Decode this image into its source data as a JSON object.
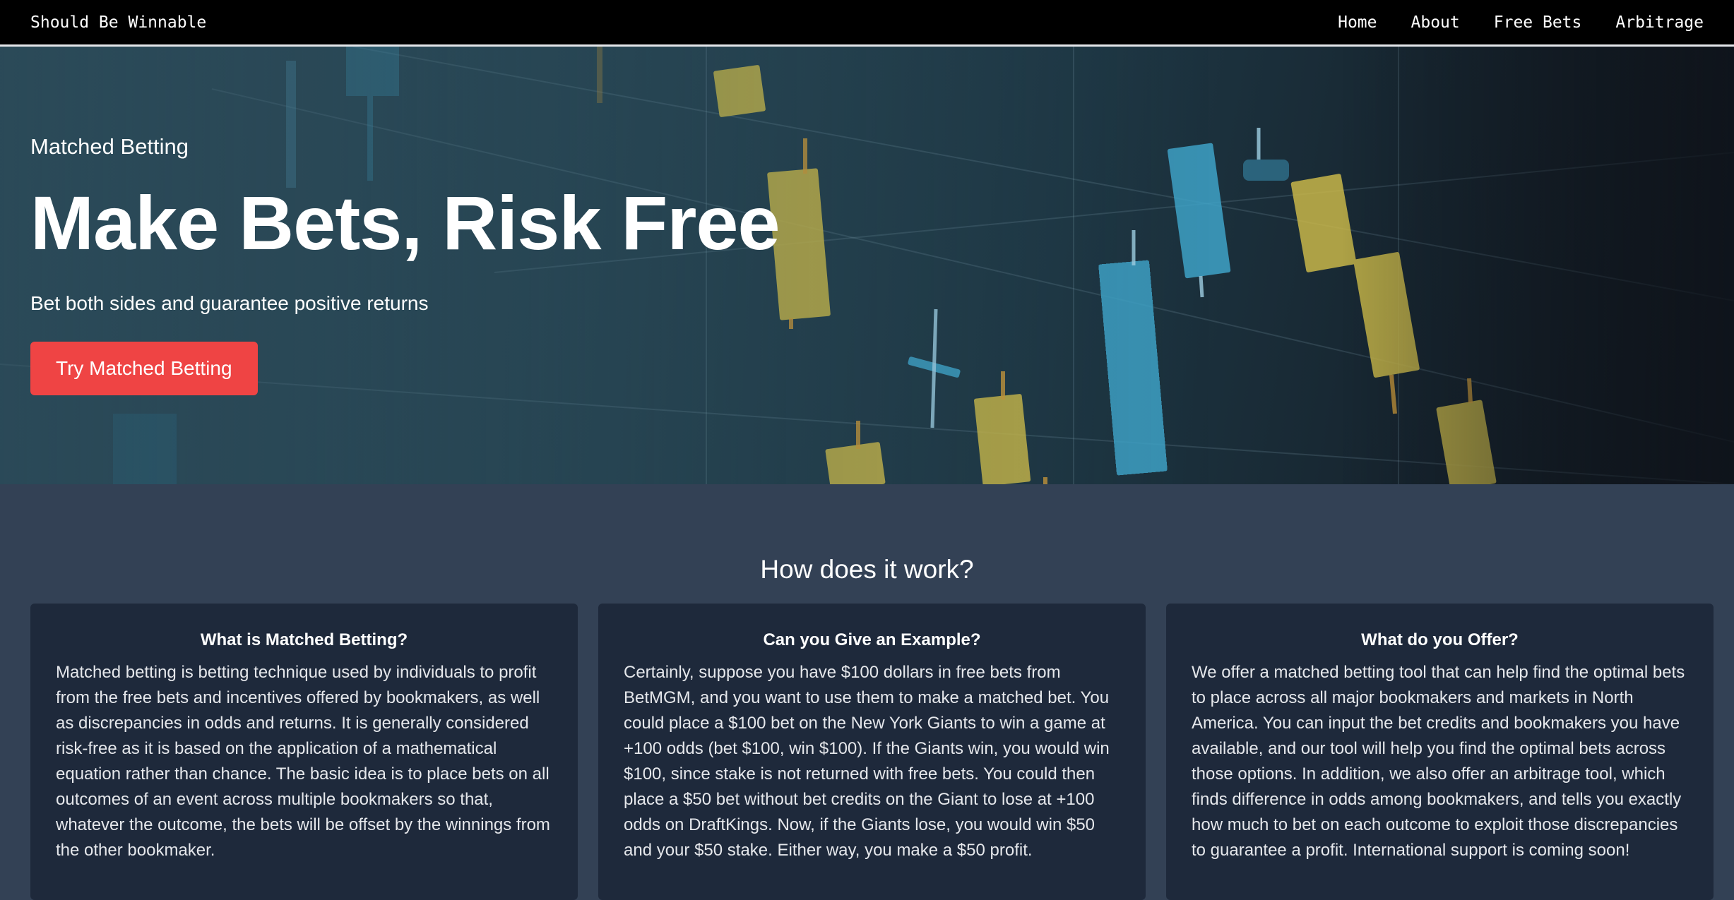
{
  "nav": {
    "brand": "Should Be Winnable",
    "links": [
      "Home",
      "About",
      "Free Bets",
      "Arbitrage"
    ]
  },
  "hero": {
    "eyebrow": "Matched Betting",
    "title": "Make Bets, Risk Free",
    "tagline": "Bet both sides and guarantee positive returns",
    "cta_label": "Try Matched Betting",
    "background_icon": "candlestick-chart"
  },
  "how": {
    "heading": "How does it work?",
    "cards": [
      {
        "title": "What is Matched Betting?",
        "body": "Matched betting is betting technique used by individuals to profit from the free bets and incentives offered by bookmakers, as well as discrepancies in odds and returns. It is generally considered risk-free as it is based on the application of a mathematical equation rather than chance. The basic idea is to place bets on all outcomes of an event across multiple bookmakers so that, whatever the outcome, the bets will be offset by the winnings from the other bookmaker."
      },
      {
        "title": "Can you Give an Example?",
        "body": "Certainly, suppose you have $100 dollars in free bets from BetMGM, and you want to use them to make a matched bet. You could place a $100 bet on the New York Giants to win a game at +100 odds (bet $100, win $100). If the Giants win, you would win $100, since stake is not returned with free bets. You could then place a $50 bet without bet credits on the Giant to lose at +100 odds on DraftKings. Now, if the Giants lose, you would win $50 and your $50 stake. Either way, you make a $50 profit."
      },
      {
        "title": "What do you Offer?",
        "body": "We offer a matched betting tool that can help find the optimal bets to place across all major bookmakers and markets in North America. You can input the bet credits and bookmakers you have available, and our tool will help you find the optimal bets across those options. In addition, we also offer an arbitrage tool, which finds difference in odds among bookmakers, and tells you exactly how much to bet on each outcome to exploit those discrepancies to guarantee a profit. International support is coming soon!"
      }
    ]
  },
  "colors": {
    "navbar_bg": "#000000",
    "section_bg": "#334155",
    "card_bg": "#1e293b",
    "cta_bg": "#ef4444",
    "candle_yellow": "#c9b84a",
    "candle_blue": "#3fa3c8"
  }
}
